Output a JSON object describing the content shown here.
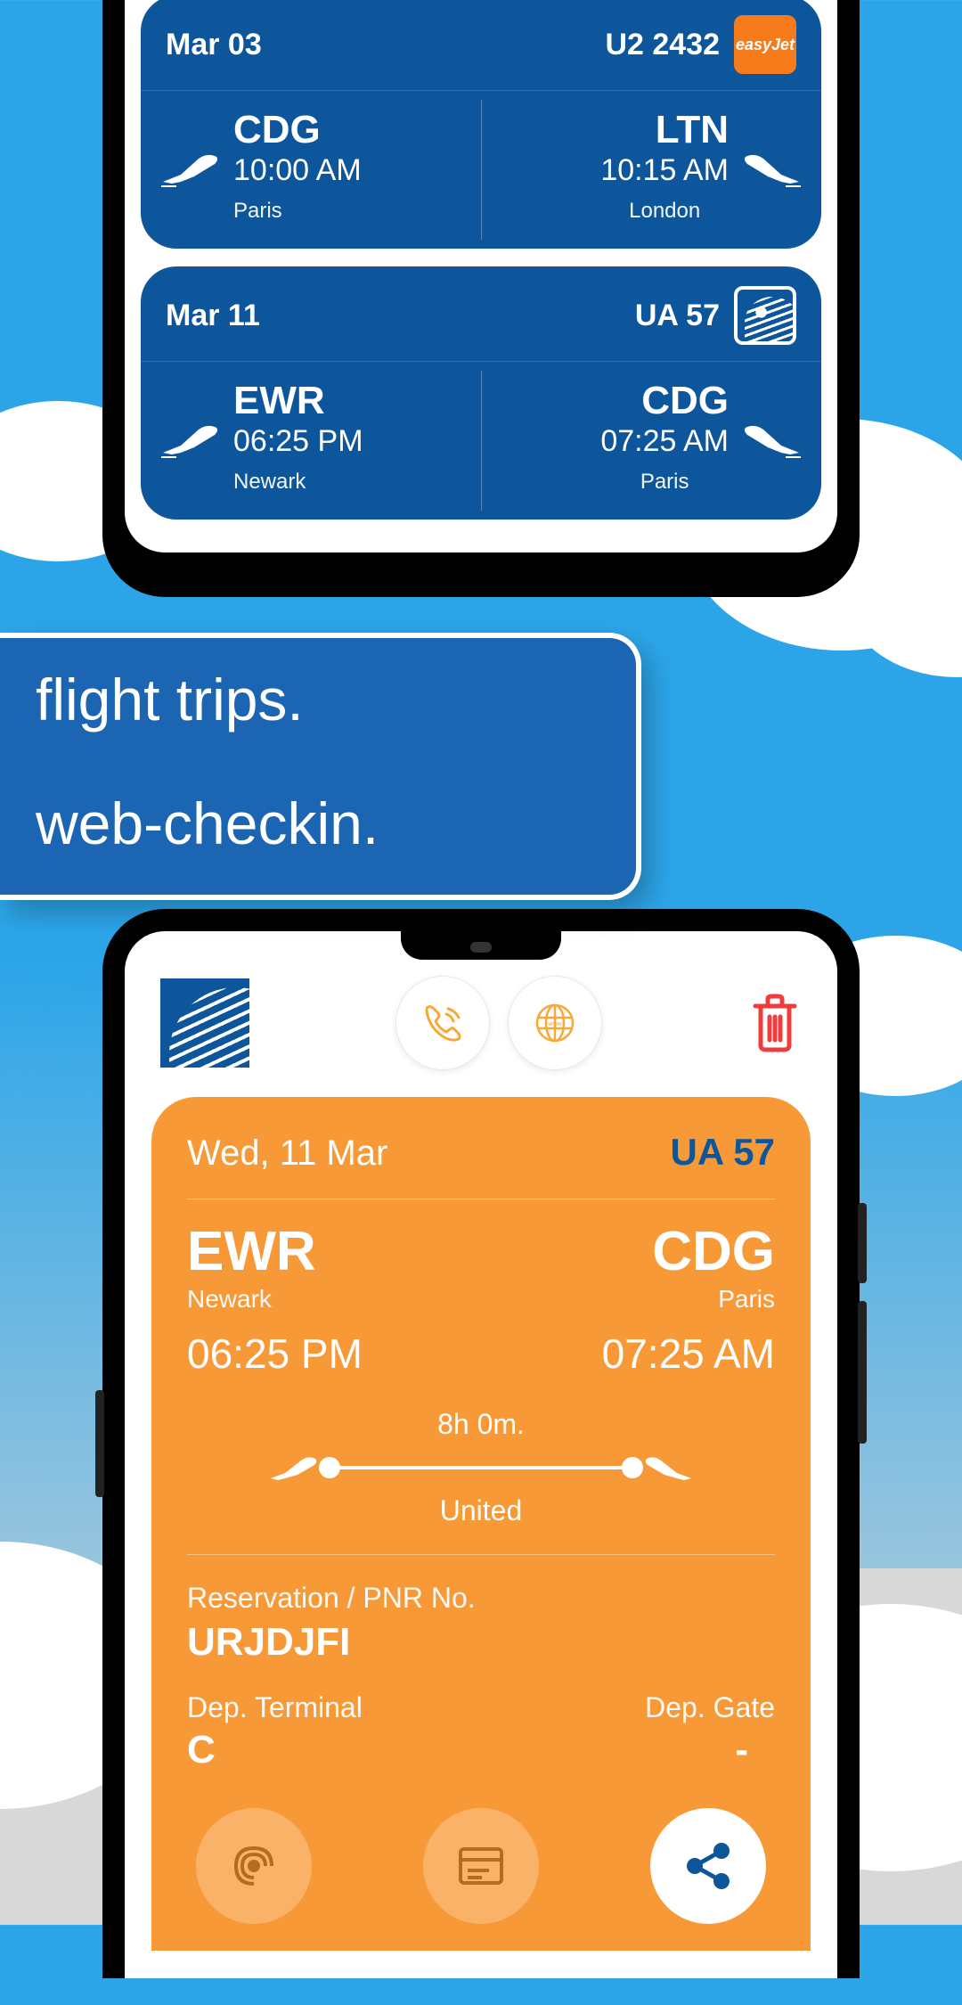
{
  "promo": {
    "line1": "flight trips.",
    "line2": "web-checkin."
  },
  "flights": [
    {
      "date": "Mar 03",
      "number": "U2 2432",
      "airline": "easyJet",
      "airline_brand_text": "easyJet",
      "dep_code": "CDG",
      "dep_time": "10:00 AM",
      "dep_city": "Paris",
      "arr_code": "LTN",
      "arr_time": "10:15 AM",
      "arr_city": "London"
    },
    {
      "date": "Mar 11",
      "number": "UA 57",
      "airline": "United",
      "dep_code": "EWR",
      "dep_time": "06:25 PM",
      "dep_city": "Newark",
      "arr_code": "CDG",
      "arr_time": "07:25 AM",
      "arr_city": "Paris"
    }
  ],
  "detail": {
    "date": "Wed, 11 Mar",
    "flight_no": "UA 57",
    "dep_code": "EWR",
    "dep_city": "Newark",
    "dep_time": "06:25 PM",
    "arr_code": "CDG",
    "arr_city": "Paris",
    "arr_time": "07:25 AM",
    "duration": "8h 0m.",
    "airline": "United",
    "pnr_label": "Reservation / PNR No.",
    "pnr_value": "URJDJFI",
    "dep_terminal_label": "Dep. Terminal",
    "dep_terminal_value": "C",
    "dep_gate_label": "Dep. Gate",
    "dep_gate_value": "-"
  },
  "colors": {
    "sky": "#2ca5e8",
    "card_blue": "#0d569b",
    "banner_blue": "#1b65b3",
    "orange": "#f89937",
    "easyjet_orange": "#f57b1b",
    "trash_red": "#ef3d3d"
  }
}
